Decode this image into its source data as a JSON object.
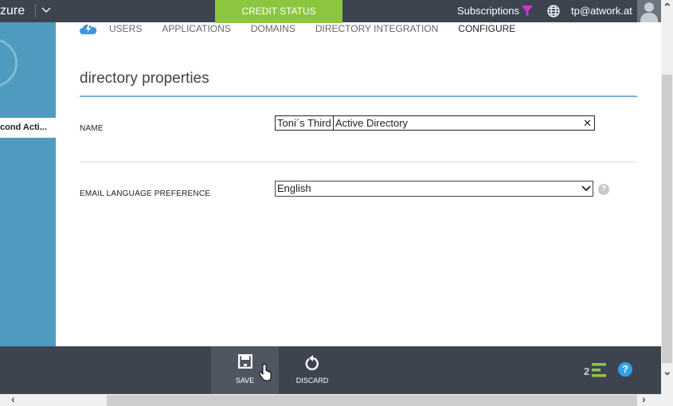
{
  "header": {
    "brand": "zure",
    "credit_status": "CREDIT STATUS",
    "subscriptions": "Subscriptions",
    "user": "tp@atwork.at"
  },
  "sidebar": {
    "item": "cond Acti..."
  },
  "tabs": [
    "USERS",
    "APPLICATIONS",
    "DOMAINS",
    "DIRECTORY INTEGRATION",
    "CONFIGURE"
  ],
  "active_tab": "CONFIGURE",
  "section_title": "directory properties",
  "form": {
    "name_label": "NAME",
    "name_value_selected": "Toni´s Third",
    "name_value_rest": "Active Directory",
    "email_label": "EMAIL LANGUAGE PREFERENCE",
    "email_value": "English"
  },
  "bottom": {
    "save": "SAVE",
    "discard": "DISCARD",
    "count": "2",
    "help": "?"
  },
  "colors": {
    "accent_green": "#8cc63f",
    "sidebar_blue": "#4e9bbf",
    "bar_dark": "#3d4450"
  }
}
